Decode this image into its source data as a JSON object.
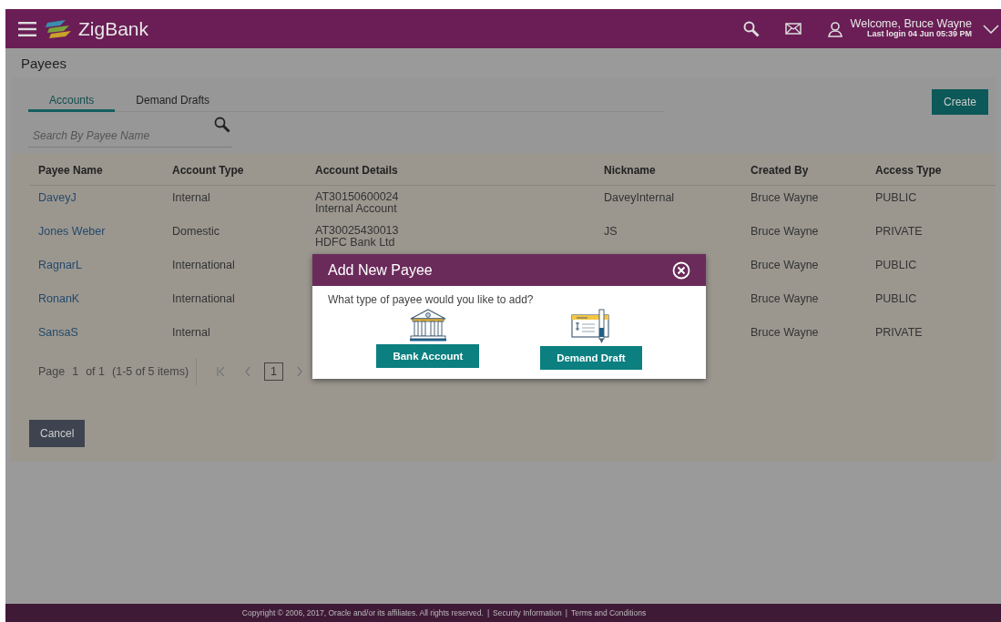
{
  "header": {
    "brand": "ZigBank",
    "welcome": "Welcome, Bruce Wayne",
    "last_login": "Last login 04 Jun 05:39 PM"
  },
  "page_title": "Payees",
  "tabs": [
    {
      "label": "Accounts",
      "selected": true
    },
    {
      "label": "Demand Drafts",
      "selected": false
    }
  ],
  "create_button": "Create",
  "search": {
    "placeholder": "Search By Payee Name"
  },
  "table": {
    "columns": [
      "Payee Name",
      "Account Type",
      "Account Details",
      "Nickname",
      "Created By",
      "Access Type"
    ],
    "rows": [
      {
        "payee_name": "DaveyJ",
        "account_type": "Internal",
        "account_details": [
          "AT30150600024",
          "Internal Account"
        ],
        "nickname": "DaveyInternal",
        "created_by": "Bruce Wayne",
        "access_type": "PUBLIC"
      },
      {
        "payee_name": "Jones Weber",
        "account_type": "Domestic",
        "account_details": [
          "AT30025430013",
          "HDFC Bank Ltd"
        ],
        "nickname": "JS",
        "created_by": "Bruce Wayne",
        "access_type": "PRIVATE"
      },
      {
        "payee_name": "RagnarL",
        "account_type": "International",
        "created_by": "Bruce Wayne",
        "access_type": "PUBLIC"
      },
      {
        "payee_name": "RonanK",
        "account_type": "International",
        "created_by": "Bruce Wayne",
        "access_type": "PUBLIC"
      },
      {
        "payee_name": "SansaS",
        "account_type": "Internal",
        "created_by": "Bruce Wayne",
        "access_type": "PRIVATE"
      }
    ]
  },
  "pagination": {
    "page_label": "Page",
    "page": "1",
    "of": "of 1",
    "summary": "(1-5 of 5 items)",
    "pages": [
      {
        "label": "1",
        "selected": true
      }
    ]
  },
  "cancel_button": "Cancel",
  "dialog": {
    "title": "Add New Payee",
    "question": "What type of payee would you like to add?",
    "options": [
      {
        "kind": "bank",
        "label": "Bank Account"
      },
      {
        "kind": "draft",
        "label": "Demand Draft"
      }
    ]
  },
  "footer": {
    "copyright": "Copyright © 2006, 2017, Oracle and/or its affiliates. All rights reserved.",
    "separator": "|",
    "links": [
      "Security Information",
      "Terms and Conditions"
    ]
  }
}
